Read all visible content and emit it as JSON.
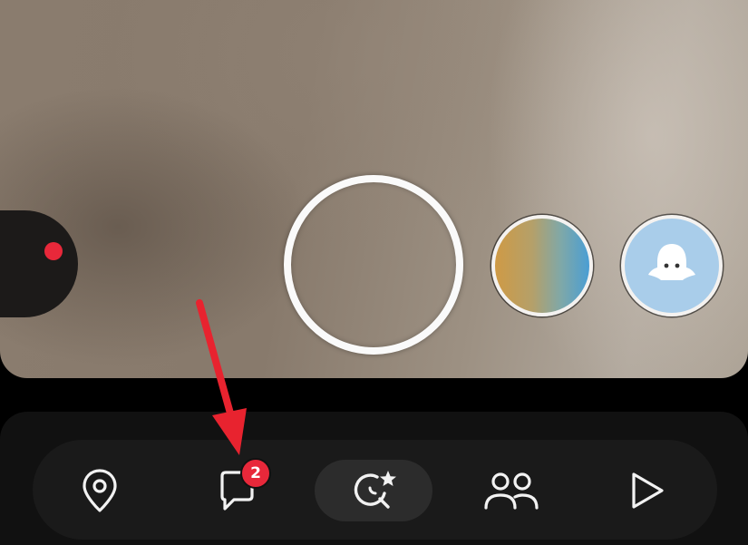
{
  "camera": {
    "lenses": [
      {
        "name": "gradient-lens"
      },
      {
        "name": "ghost-lens"
      }
    ]
  },
  "memories": {
    "has_notification": true
  },
  "nav": {
    "items": [
      {
        "icon": "map-pin-icon"
      },
      {
        "icon": "chat-icon",
        "badge": "2"
      },
      {
        "icon": "spotlight-search-icon",
        "selected": true
      },
      {
        "icon": "friends-icon"
      },
      {
        "icon": "play-icon"
      }
    ]
  },
  "annotation": {
    "color": "#e8232f"
  },
  "colors": {
    "badge": "#e8283a",
    "nav_bg": "#111111"
  }
}
